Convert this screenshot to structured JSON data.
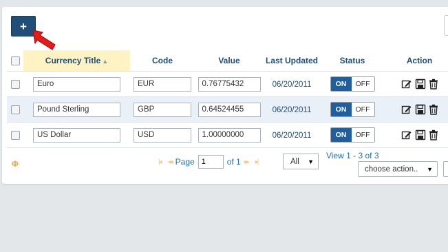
{
  "toolbar": {
    "add_label": "+"
  },
  "table": {
    "headers": {
      "currency_title": "Currency Title",
      "code": "Code",
      "value": "Value",
      "last_updated": "Last Updated",
      "status": "Status",
      "action": "Action"
    },
    "rows": [
      {
        "title": "Euro",
        "code": "EUR",
        "value": "0.76775432",
        "updated": "06/20/2011",
        "on": "ON",
        "off": "OFF",
        "selected": false
      },
      {
        "title": "Pound Sterling",
        "code": "GBP",
        "value": "0.64524455",
        "updated": "06/20/2011",
        "on": "ON",
        "off": "OFF",
        "selected": true
      },
      {
        "title": "US Dollar",
        "code": "USD",
        "value": "1.00000000",
        "updated": "06/20/2011",
        "on": "ON",
        "off": "OFF",
        "selected": false
      }
    ]
  },
  "footer": {
    "refresh_icon": "Φ",
    "first_icon": "|◂",
    "prev_icon": "◂◂",
    "next_icon": "▸▸",
    "last_icon": "▸|",
    "page_label": "Page",
    "page_value": "1",
    "of_label": "of 1",
    "per_page": "All",
    "view_info": "View 1 - 3 of 3",
    "action_select": "choose action.."
  },
  "colors": {
    "accent": "#1f4e79",
    "toggle_on": "#1f5f9e",
    "sort_header_bg": "#fff3c4",
    "arrow": "#e21b1b"
  }
}
